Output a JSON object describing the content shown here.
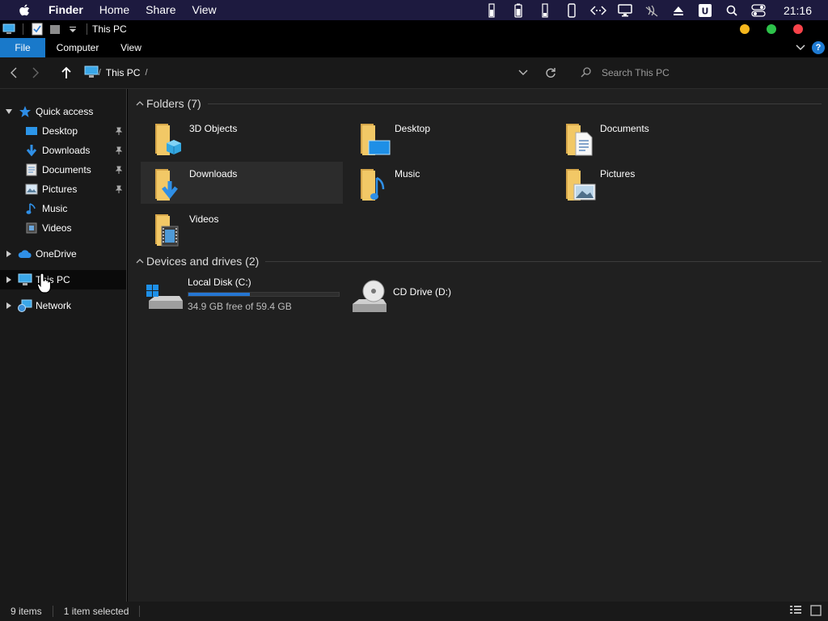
{
  "menubar": {
    "app_name": "Finder",
    "items": [
      "Home",
      "Share",
      "View"
    ],
    "clock": "21:16",
    "tray_icons": [
      "memory-icon",
      "battery-icon",
      "cpu-icon",
      "phone-icon",
      "code-icon",
      "display-icon",
      "mute-icon",
      "eject-icon",
      "u-app-icon",
      "search-icon",
      "control-center-icon"
    ]
  },
  "titlebar": {
    "title": "This PC",
    "dots": {
      "minimize": "#f5b71d",
      "maximize": "#2dc24a",
      "close": "#f8434a"
    }
  },
  "ribbon": {
    "tabs": [
      "File",
      "Computer",
      "View"
    ],
    "help": "?"
  },
  "address": {
    "crumb": "This PC",
    "search_placeholder": "Search This PC"
  },
  "sidebar": {
    "quick_access": "Quick access",
    "quick_items": [
      {
        "label": "Desktop",
        "pinned": true
      },
      {
        "label": "Downloads",
        "pinned": true
      },
      {
        "label": "Documents",
        "pinned": true
      },
      {
        "label": "Pictures",
        "pinned": true
      },
      {
        "label": "Music",
        "pinned": false
      },
      {
        "label": "Videos",
        "pinned": false
      }
    ],
    "onedrive": "OneDrive",
    "this_pc": "This PC",
    "network": "Network"
  },
  "content": {
    "folders_header": "Folders (7)",
    "folders": [
      "3D Objects",
      "Desktop",
      "Documents",
      "Downloads",
      "Music",
      "Pictures",
      "Videos"
    ],
    "devices_header": "Devices and drives (2)",
    "drives": [
      {
        "name": "Local Disk (C:)",
        "free": "34.9 GB free of 59.4 GB",
        "used_fraction": 0.41
      },
      {
        "name": "CD Drive (D:)"
      }
    ]
  },
  "status": {
    "items": "9 items",
    "selected": "1 item selected"
  },
  "colors": {
    "accent": "#1979ca",
    "folder": "#f2c866",
    "menubar": "#1d1a3f"
  }
}
